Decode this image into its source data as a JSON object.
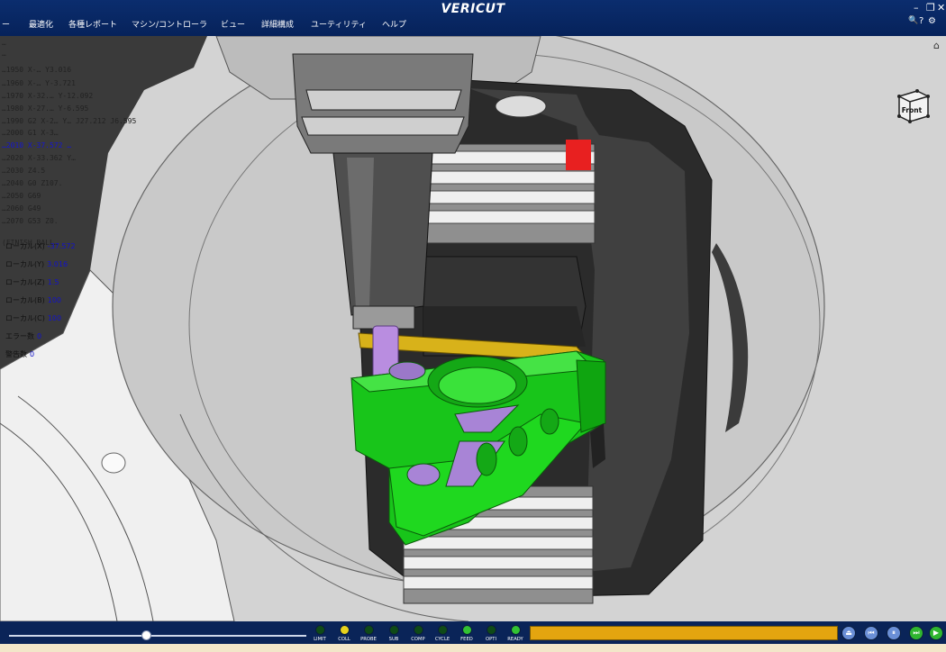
{
  "app": {
    "title": "VERICUT"
  },
  "menu": {
    "items": [
      "ー",
      "最適化",
      "各種レポート",
      "マシン/コントローラ",
      "ビュー",
      "詳細構成",
      "ユーティリティ",
      "ヘルプ"
    ]
  },
  "window_controls": {
    "minimize": "–",
    "restore": "❐",
    "close": "✕",
    "help": "?"
  },
  "nc_program": {
    "lines": [
      {
        "text": "…",
        "active": false
      },
      {
        "text": "…",
        "active": false
      },
      {
        "text": "…1950 X-…  Y3.016",
        "active": false
      },
      {
        "text": "…1960 X-…  Y-3.721",
        "active": false
      },
      {
        "text": "…1970 X-32.…  Y-12.092",
        "active": false
      },
      {
        "text": "…1980 X-27.…  Y-6.595",
        "active": false
      },
      {
        "text": "…1990 G2 X-2…  Y…  J27.212 J6.595",
        "active": false
      },
      {
        "text": "…2000 G1 X-3…",
        "active": false
      },
      {
        "text": "…2010 X-37.572 …",
        "active": true
      },
      {
        "text": "…2020 X-33.362 Y…",
        "active": false
      },
      {
        "text": "…2030 Z4.5",
        "active": false
      },
      {
        "text": "…2040 G0 Z107.",
        "active": false
      },
      {
        "text": "…2050 G69",
        "active": false
      },
      {
        "text": "…2060 G49",
        "active": false
      },
      {
        "text": "…2070 G53 Z0.",
        "active": false
      },
      {
        "text": "(FINISH BALL…",
        "active": false
      }
    ]
  },
  "readouts": [
    {
      "label": "ローカル(X)",
      "value": "-37.572"
    },
    {
      "label": "ローカル(Y)",
      "value": "3.016"
    },
    {
      "label": "ローカル(Z)",
      "value": "1.5"
    },
    {
      "label": "ローカル(B)",
      "value": "100"
    },
    {
      "label": "ローカル(C)",
      "value": "100"
    },
    {
      "label": "エラー数",
      "value": "0"
    },
    {
      "label": "警告数",
      "value": "0"
    }
  ],
  "view_cube": {
    "label": "Front"
  },
  "status": {
    "leds": [
      {
        "label": "LIMIT",
        "color": "#0f4a17"
      },
      {
        "label": "COLL",
        "color": "#e8d21c"
      },
      {
        "label": "PROBE",
        "color": "#0f4a17"
      },
      {
        "label": "SUB",
        "color": "#0f4a17"
      },
      {
        "label": "COMP",
        "color": "#0f4a17"
      },
      {
        "label": "CYCLE",
        "color": "#0f4a17"
      },
      {
        "label": "FEED",
        "color": "#33c233"
      },
      {
        "label": "OPTI",
        "color": "#0f4a17"
      },
      {
        "label": "READY",
        "color": "#33c233"
      }
    ],
    "slider_position": 0.46,
    "playback": [
      {
        "name": "eject-button",
        "glyph": "⏏",
        "color": "#6a8fd6"
      },
      {
        "name": "rewind-button",
        "glyph": "⏮",
        "color": "#6a8fd6"
      },
      {
        "name": "pause-button",
        "glyph": "⏸",
        "color": "#6a8fd6"
      },
      {
        "name": "step-button",
        "glyph": "⏭",
        "color": "#2fb52f"
      },
      {
        "name": "play-button",
        "glyph": "▶",
        "color": "#2fb52f"
      }
    ]
  }
}
